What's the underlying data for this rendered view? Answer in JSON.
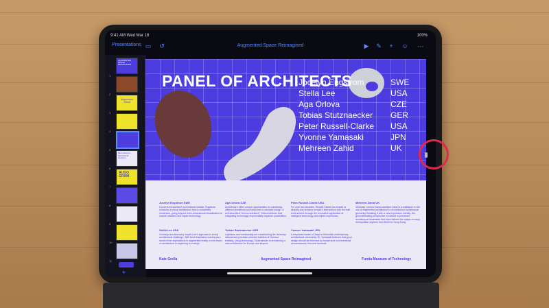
{
  "status_bar": {
    "time": "9:41 AM  Wed Mar 18",
    "right": "100%"
  },
  "toolbar": {
    "back_label": "Presentations",
    "document_title": "Augmented Space Reimagined",
    "icons": [
      "sidebar-icon",
      "undo-icon",
      "play-icon",
      "pen-icon",
      "add-icon",
      "collaborate-icon",
      "more-icon"
    ]
  },
  "navigator": {
    "slide_numbers": [
      "1",
      "2",
      "3",
      "4",
      "5",
      "6",
      "7",
      "8",
      "9",
      "10",
      "11"
    ],
    "selected": 5,
    "thumb_texts": [
      "AUGMENTED SPACE REIMAGINED",
      "",
      "Augmented Virtual",
      "",
      "",
      "Micro-Electro-Mechanical Systems",
      "AUGO GRAM",
      "",
      "",
      "",
      ""
    ],
    "add_label": "+"
  },
  "slide": {
    "title": "PANEL OF ARCHITECTS",
    "architects": [
      {
        "name": "Jocelyn Engstrom",
        "country": "SWE"
      },
      {
        "name": "Stella Lee",
        "country": "USA"
      },
      {
        "name": "Aga Orlova",
        "country": "CZE"
      },
      {
        "name": "Tobias Stutznaecker",
        "country": "GER"
      },
      {
        "name": "Peter Russell-Clarke",
        "country": "USA"
      },
      {
        "name": "Yvonne Yamasaki",
        "country": "JPN"
      },
      {
        "name": "Mehreen Zahid",
        "country": "UK"
      }
    ],
    "bios": [
      {
        "heading": "Jocelyn Engstrom SWE",
        "text": "A prominent architect and eminent scholar, Engstrom envisions a virtual architecture that is completely immersive, going beyond three-dimensional visualization to include olfactory and haptic technology."
      },
      {
        "heading": "Stella Lee USA",
        "text": "Curiosity and discovery inspire Lee's approach to every architectural challenge. With fresh inspiration coming as a result of her explorations in augmented reality, a new realm of architecture is beginning to emerge."
      },
      {
        "heading": "Aga Orlova CZE",
        "text": "Architecture offers unique opportunities for combining different disciplines and ideas into a cohesive design. A self-described \"techno-architect,\" Orlova believes that integrating technology exponentially expands possibilities."
      },
      {
        "heading": "Tobias Stutznaecker GER",
        "text": "Lightness and emotionality are transforming the famously rational and precision-oriented tradition of German building. Using technology, Stutznaecker is envisioning a new architecture for Europe and beyond."
      },
      {
        "heading": "Peter Russell-Clarke USA",
        "text": "For over two decades, Russell-Clarke has strived to simplify and enhance people's interactions with the built environment through the innovative application of intelligent technology and artistic expression."
      },
      {
        "heading": "Yvonne Yamasaki JPN",
        "text": "A respected leader of Tokyo's influential contemporary architectural community, Dr. Yamasaki believes that good design should be informed by human and environmental circumstances, first and foremost."
      },
      {
        "heading": "Mehreen Zahid UK",
        "text": "Visionary London-based architect Zahid is a trailblazer in the use of augmented architecture to revolutionize architectural geometry. Breaking it with a new expressive identity. Her groundbreaking perspective is evident in prominent architectural landmarks that have defined the shape of many metropolitan skylines from Berlin to Hong Kong."
      }
    ],
    "footer": {
      "left": "Kate Grella",
      "center": "Augmented Space Reimagined",
      "right": "Funda Museum of Technology"
    }
  },
  "colors": {
    "accent": "#5b8cff",
    "slide_purple": "#4d3ce0",
    "highlight": "#e0294b"
  }
}
